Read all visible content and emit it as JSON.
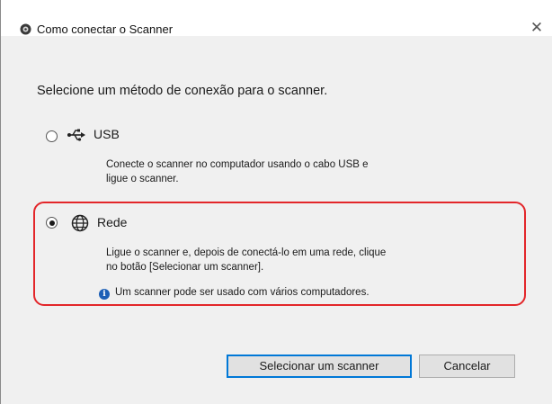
{
  "window": {
    "title": "Como conectar o Scanner",
    "close_symbol": "✕"
  },
  "prompt": "Selecione um método de conexão para o scanner.",
  "options": [
    {
      "label": "USB",
      "selected": false,
      "icon": "usb-icon",
      "description_lines": [
        "Conecte o scanner no computador usando o cabo USB e",
        "ligue o scanner."
      ]
    },
    {
      "label": "Rede",
      "selected": true,
      "icon": "globe-icon",
      "description_lines": [
        "Ligue o scanner e, depois de conectá-lo em uma rede, clique",
        "no botão [Selecionar um scanner]."
      ],
      "info": "Um scanner pode ser usado com vários computadores."
    }
  ],
  "buttons": {
    "select_scanner": "Selecionar um scanner",
    "cancel": "Cancelar"
  },
  "colors": {
    "highlight": "#e3262a",
    "default_button_border": "#0078d7",
    "info_icon": "#1c5fb6"
  }
}
